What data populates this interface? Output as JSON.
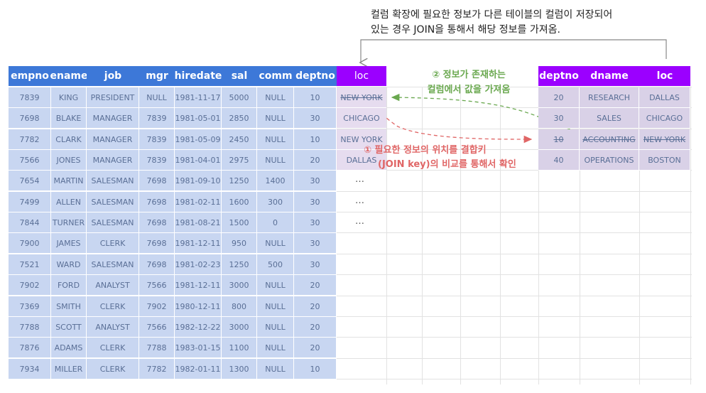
{
  "caption": {
    "line1": "컬럼 확장에 필요한 정보가 다른 테이블의 컬럼이 저장되어",
    "line2": "있는 경우 JOIN을 통해서 해당 정보를 가져옴."
  },
  "emp_table": {
    "headers": [
      "empno",
      "ename",
      "job",
      "mgr",
      "hiredate",
      "sal",
      "comm",
      "deptno"
    ],
    "rows": [
      [
        "7839",
        "KING",
        "PRESIDENT",
        "NULL",
        "1981-11-17",
        "5000",
        "NULL",
        "10"
      ],
      [
        "7698",
        "BLAKE",
        "MANAGER",
        "7839",
        "1981-05-01",
        "2850",
        "NULL",
        "30"
      ],
      [
        "7782",
        "CLARK",
        "MANAGER",
        "7839",
        "1981-05-09",
        "2450",
        "NULL",
        "10"
      ],
      [
        "7566",
        "JONES",
        "MANAGER",
        "7839",
        "1981-04-01",
        "2975",
        "NULL",
        "20"
      ],
      [
        "7654",
        "MARTIN",
        "SALESMAN",
        "7698",
        "1981-09-10",
        "1250",
        "1400",
        "30"
      ],
      [
        "7499",
        "ALLEN",
        "SALESMAN",
        "7698",
        "1981-02-11",
        "1600",
        "300",
        "30"
      ],
      [
        "7844",
        "TURNER",
        "SALESMAN",
        "7698",
        "1981-08-21",
        "1500",
        "0",
        "30"
      ],
      [
        "7900",
        "JAMES",
        "CLERK",
        "7698",
        "1981-12-11",
        "950",
        "NULL",
        "30"
      ],
      [
        "7521",
        "WARD",
        "SALESMAN",
        "7698",
        "1981-02-23",
        "1250",
        "500",
        "30"
      ],
      [
        "7902",
        "FORD",
        "ANALYST",
        "7566",
        "1981-12-11",
        "3000",
        "NULL",
        "20"
      ],
      [
        "7369",
        "SMITH",
        "CLERK",
        "7902",
        "1980-12-11",
        "800",
        "NULL",
        "20"
      ],
      [
        "7788",
        "SCOTT",
        "ANALYST",
        "7566",
        "1982-12-22",
        "3000",
        "NULL",
        "20"
      ],
      [
        "7876",
        "ADAMS",
        "CLERK",
        "7788",
        "1983-01-15",
        "1100",
        "NULL",
        "20"
      ],
      [
        "7934",
        "MILLER",
        "CLERK",
        "7782",
        "1982-01-11",
        "1300",
        "NULL",
        "10"
      ]
    ]
  },
  "loc_column": {
    "header": "loc",
    "values": [
      "NEW YORK",
      "CHICAGO",
      "NEW YORK",
      "DALLAS"
    ],
    "ellipsis": [
      "…",
      "…",
      "…"
    ]
  },
  "dept_table": {
    "headers": [
      "deptno",
      "dname",
      "loc"
    ],
    "rows": [
      [
        "20",
        "RESEARCH",
        "DALLAS"
      ],
      [
        "30",
        "SALES",
        "CHICAGO"
      ],
      [
        "10",
        "ACCOUNTING",
        "NEW YORK"
      ],
      [
        "40",
        "OPERATIONS",
        "BOSTON"
      ]
    ]
  },
  "annotations": {
    "green_line1": "② 정보가  존재하는",
    "green_line2": "컬럼에서 값을 가져옴",
    "red_line1": "① 필요한 정보의 위치를 결합키",
    "red_line2": "(JOIN key)의 비교를 통해서 확인"
  },
  "colors": {
    "emp_header": "#3d78d8",
    "dept_header": "#9b00ff",
    "emp_cell": "#c8d6f1",
    "dept_cell": "#d9d1e7",
    "green_arrow": "#6aa84f",
    "red_arrow": "#e06666"
  }
}
